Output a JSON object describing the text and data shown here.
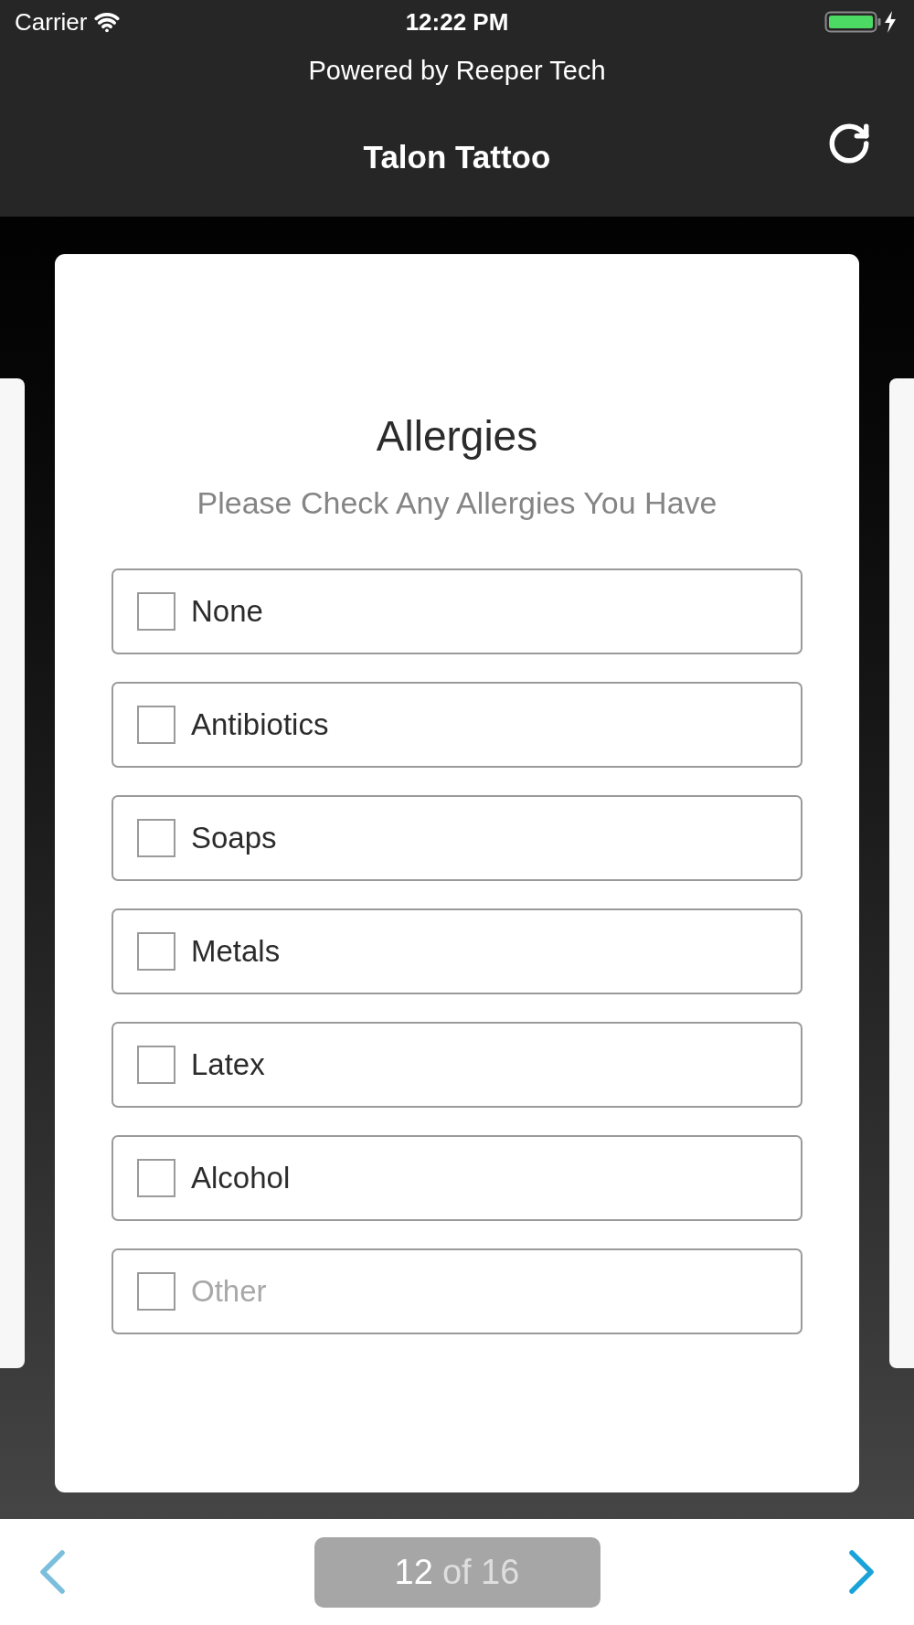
{
  "status_bar": {
    "carrier": "Carrier",
    "time": "12:22 PM"
  },
  "header": {
    "powered_by": "Powered by Reeper Tech",
    "title": "Talon Tattoo"
  },
  "form": {
    "title": "Allergies",
    "subtitle": "Please Check Any Allergies You Have",
    "options": [
      {
        "kind": "checkbox",
        "label": "None",
        "checked": false
      },
      {
        "kind": "checkbox",
        "label": "Antibiotics",
        "checked": false
      },
      {
        "kind": "checkbox",
        "label": "Soaps",
        "checked": false
      },
      {
        "kind": "checkbox",
        "label": "Metals",
        "checked": false
      },
      {
        "kind": "checkbox",
        "label": "Latex",
        "checked": false
      },
      {
        "kind": "checkbox",
        "label": "Alcohol",
        "checked": false
      },
      {
        "kind": "text_entry",
        "placeholder": "Other",
        "checked": false
      }
    ]
  },
  "pager": {
    "previous": {
      "disabled": true
    },
    "next": {
      "disabled": false
    },
    "current": "12",
    "total_text": "of 16"
  }
}
